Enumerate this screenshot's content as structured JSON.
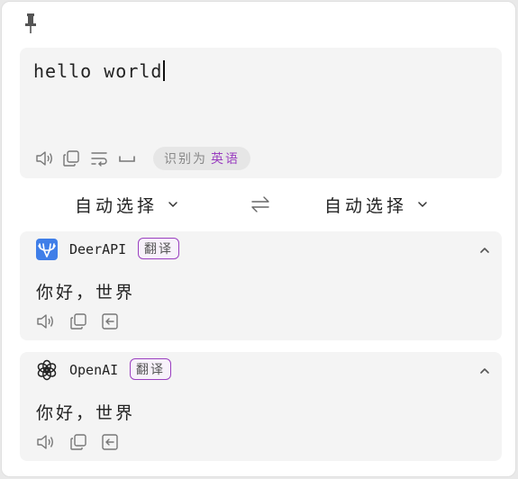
{
  "source": {
    "text": "hello world",
    "detected_prefix": "识别为",
    "detected_lang": "英语"
  },
  "languages": {
    "from": "自动选择",
    "to": "自动选择"
  },
  "results": [
    {
      "service": "DeerAPI",
      "tag": "翻译",
      "text": "你好，世界"
    },
    {
      "service": "OpenAI",
      "tag": "翻译",
      "text": "你好，世界"
    }
  ],
  "colors": {
    "accent": "#9a3fc0",
    "deer_logo": "#3f7ee8",
    "card_bg": "#f4f4f4"
  },
  "icons": [
    "pin-icon",
    "speaker-icon",
    "copy-icon",
    "wrap-icon",
    "space-icon",
    "chevron-down-icon",
    "swap-icon",
    "chevron-up-icon",
    "insert-icon",
    "deer-logo",
    "openai-logo"
  ]
}
